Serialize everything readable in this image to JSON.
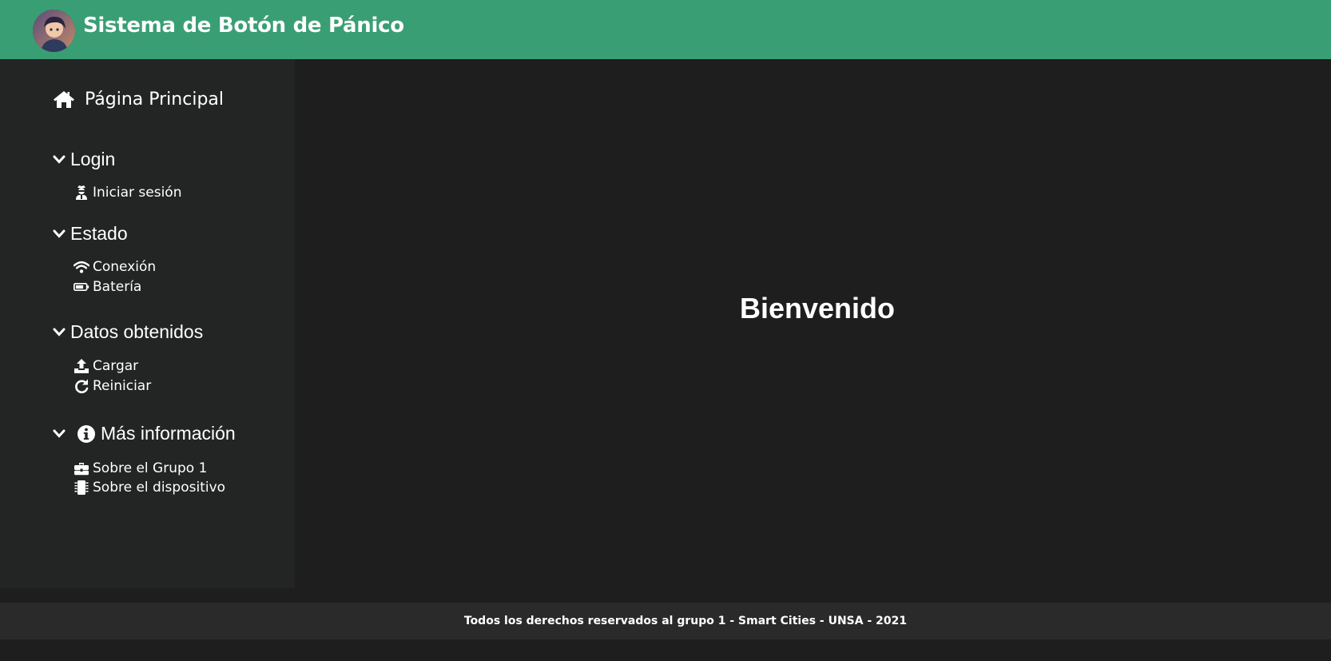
{
  "header": {
    "title": "Sistema de Botón de Pánico",
    "avatar_icon": "user-avatar",
    "background_color": "#3a9e74"
  },
  "sidebar": {
    "home": {
      "label": "Página Principal",
      "icon": "home-icon"
    },
    "sections": [
      {
        "label": "Login",
        "items": [
          {
            "label": "Iniciar sesión",
            "icon": "user-secret-icon"
          }
        ]
      },
      {
        "label": "Estado",
        "items": [
          {
            "label": "Conexión",
            "icon": "wifi-icon"
          },
          {
            "label": "Batería",
            "icon": "battery-icon"
          }
        ]
      },
      {
        "label": "Datos obtenidos",
        "items": [
          {
            "label": "Cargar",
            "icon": "upload-icon"
          },
          {
            "label": "Reiniciar",
            "icon": "redo-icon"
          }
        ]
      },
      {
        "label": "Más información",
        "icon": "info-circle-icon",
        "items": [
          {
            "label": "Sobre el Grupo 1",
            "icon": "briefcase-icon"
          },
          {
            "label": "Sobre el dispositivo",
            "icon": "microchip-icon"
          }
        ]
      }
    ]
  },
  "main": {
    "welcome": "Bienvenido"
  },
  "footer": {
    "text": "Todos los derechos reservados al grupo 1 - Smart Cities - UNSA - 2021"
  }
}
